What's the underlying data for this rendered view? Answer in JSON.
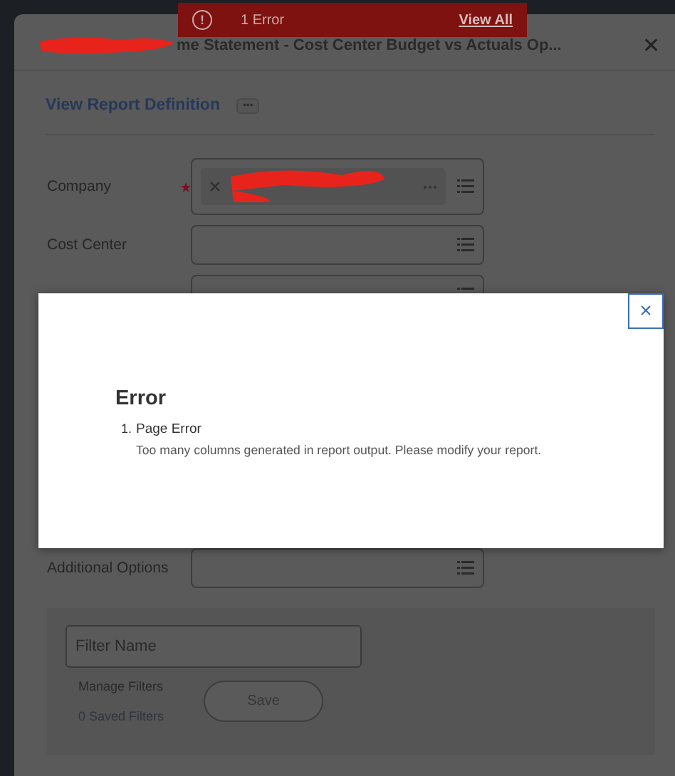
{
  "banner": {
    "icon": "!",
    "message": "1 Error",
    "link": "View All"
  },
  "window": {
    "title": "me Statement - Cost Center Budget vs Actuals Op...",
    "close": "✕"
  },
  "header": {
    "link": "View Report Definition",
    "more": "•••"
  },
  "fields": [
    {
      "label": "Company",
      "required": true,
      "kind": "chip"
    },
    {
      "label": "Cost Center",
      "required": false,
      "kind": "empty"
    },
    {
      "required": false,
      "kind": "empty"
    }
  ],
  "last_field": {
    "label": "Additional Options",
    "required": false,
    "kind": "empty"
  },
  "filters": {
    "placeholder": "Filter Name",
    "manage": "Manage Filters",
    "saved": "0 Saved Filters",
    "save": "Save"
  },
  "modal": {
    "close": "×",
    "heading": "Error",
    "errors": [
      {
        "number": "1.",
        "title": "Page Error",
        "detail": "Too many columns generated in report output. Please modify your report."
      }
    ]
  }
}
